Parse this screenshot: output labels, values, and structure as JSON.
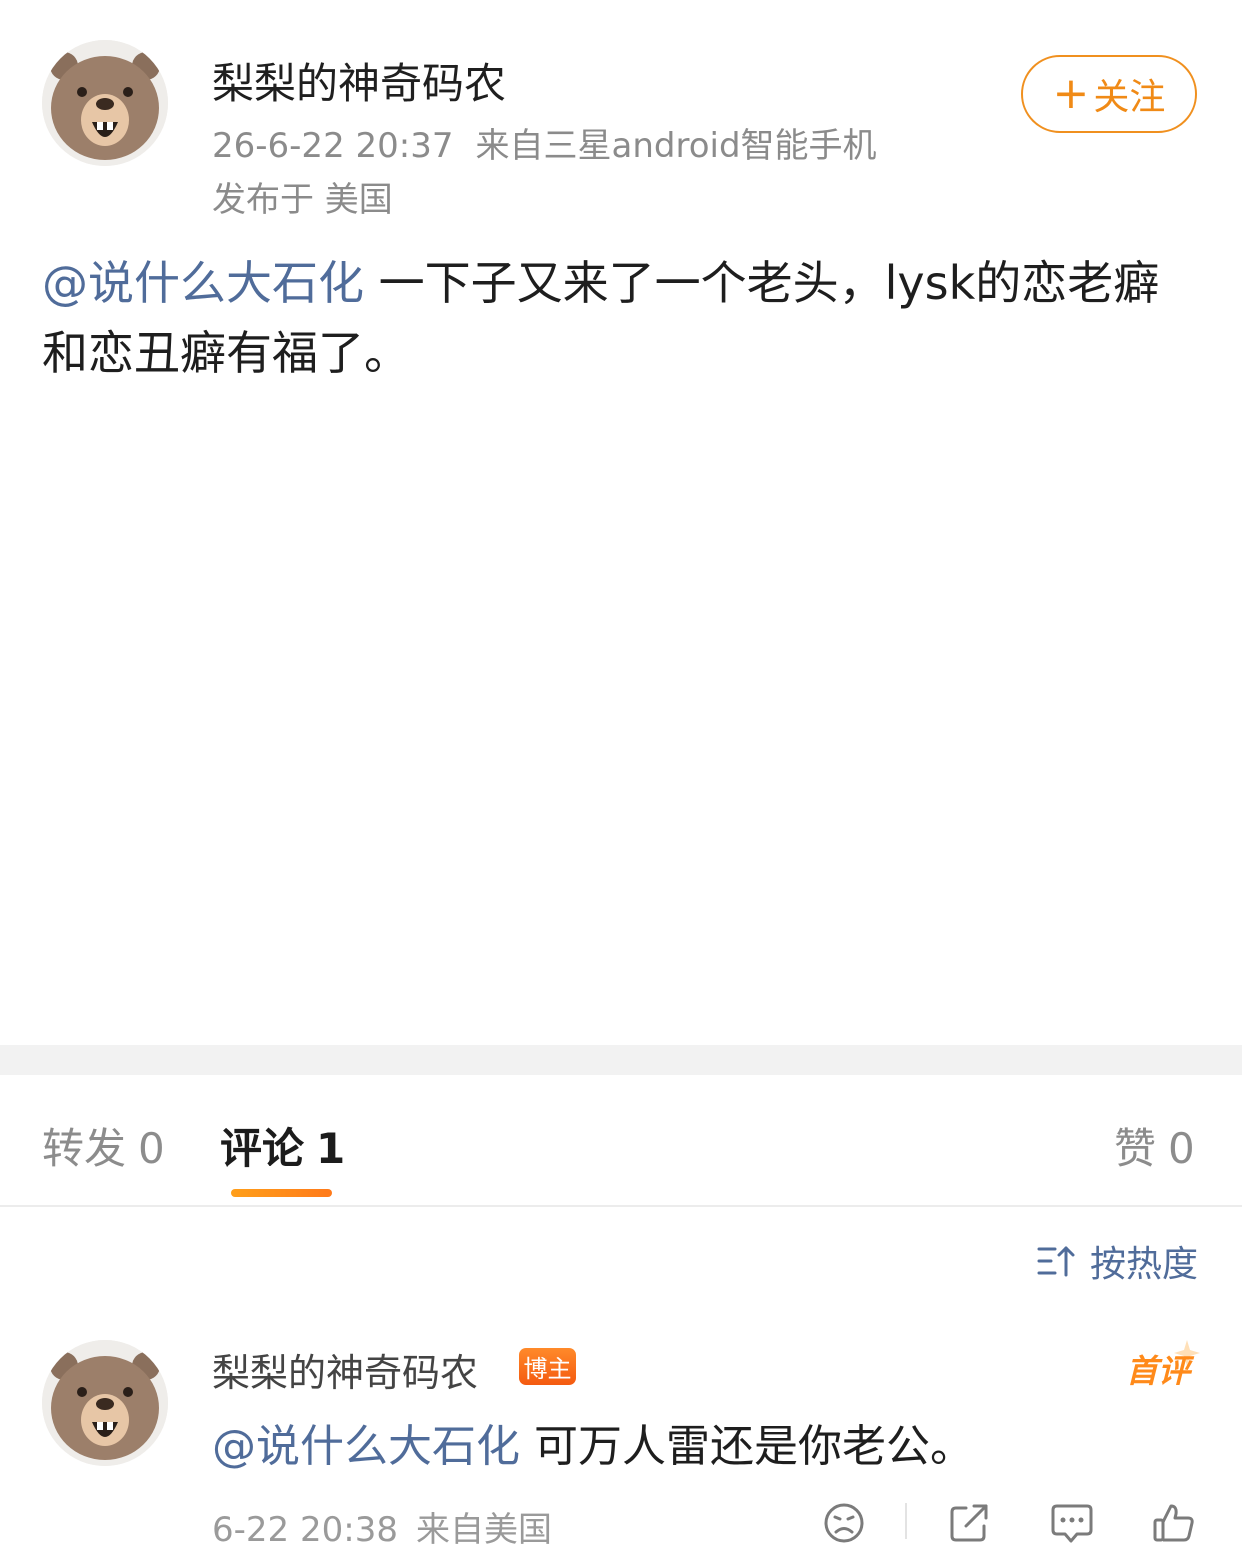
{
  "post": {
    "username": "梨梨的神奇码农",
    "time": "26-6-22 20:37",
    "source": "来自三星android智能手机",
    "location": "发布于 美国",
    "follow_plus": "+",
    "follow_label": "关注",
    "mention": "@说什么大石化",
    "text": " 一下子又来了一个老头，lysk的恋老癖和恋丑癖有福了。"
  },
  "tabs": {
    "repost_label": "转发",
    "repost_count": "0",
    "comments_label": "评论",
    "comments_count": "1",
    "likes_label": "赞",
    "likes_count": "0",
    "active_indicator_color": "#ff8a1a"
  },
  "sort": {
    "label": "按热度",
    "icon": "sort-icon"
  },
  "comment": {
    "username": "梨梨的神奇码农",
    "badge": "博主",
    "first_tag": "首评",
    "mention": "@说什么大石化",
    "text": " 可万人雷还是你老公。",
    "time": "6-22 20:38",
    "location": "来自美国",
    "actions": [
      "dislike-icon",
      "share-icon",
      "reply-icon",
      "like-icon"
    ]
  },
  "colors": {
    "accent_orange": "#f08a16",
    "link_blue": "#506c9a",
    "meta_gray": "#8b8b8b"
  }
}
